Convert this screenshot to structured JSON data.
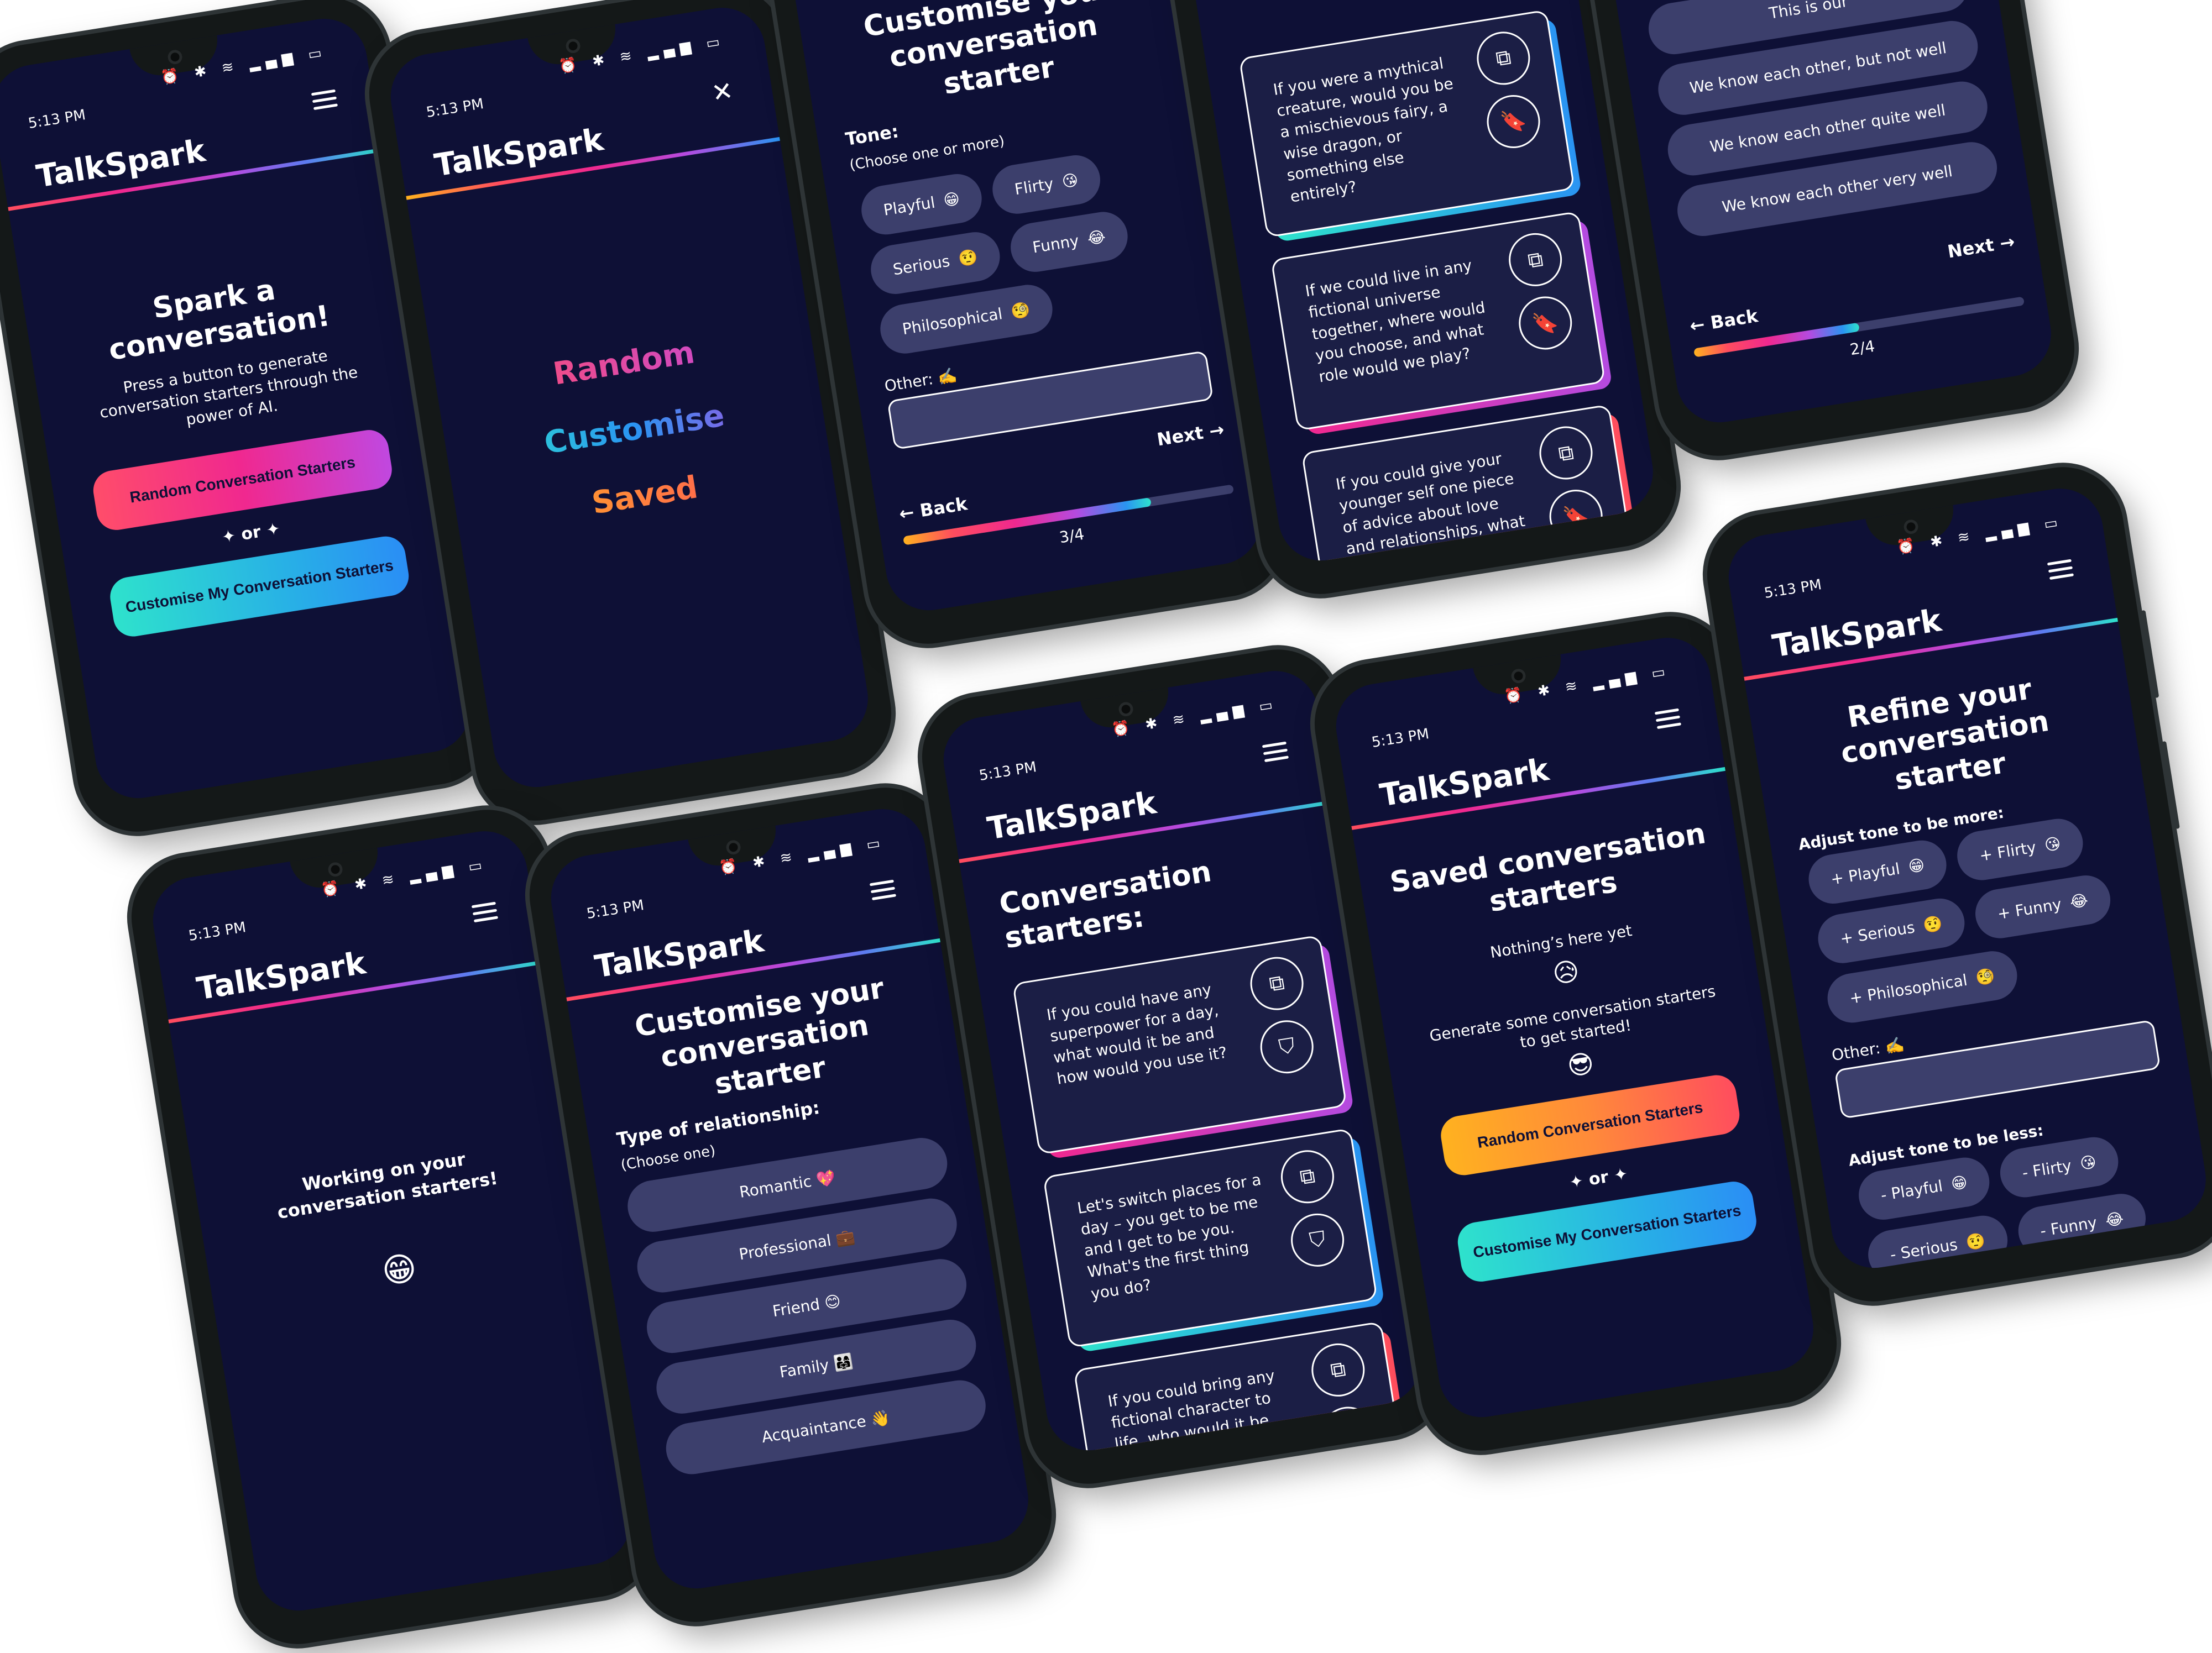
{
  "app": {
    "brand": "TalkSpark",
    "status_time": "5:13 PM",
    "status_icons": [
      "alarm-icon",
      "bluetooth-icon",
      "wifi-icon",
      "signal-icon",
      "battery-icon"
    ],
    "status_glyphs": "⏰ ✱ ≋ ▂▄▆ ▭",
    "colors": {
      "background": "#0e1036",
      "chip": "#3c3f6c",
      "card": "#1b1e45",
      "pink": "#f0288f",
      "purple": "#b44be0",
      "blue": "#2a94f2",
      "teal": "#2ee2cc",
      "orange": "#ffb21f",
      "red": "#ff4d5e"
    }
  },
  "screens": {
    "home": {
      "title": "Spark a conversation!",
      "subtitle": "Press a button to generate conversation starters through the power of AI.",
      "random_button": "Random Conversation Starters",
      "or_label": "✦ or ✦",
      "customise_button": "Customise My Conversation Starters"
    },
    "menu": {
      "close_glyph": "✕",
      "items": [
        "Random",
        "Customise",
        "Saved"
      ]
    },
    "tone_step": {
      "title": "Customise your conversation starter",
      "label": "Tone:",
      "hint": "(Choose one or more)",
      "options": [
        {
          "label": "Playful",
          "emoji": "😁"
        },
        {
          "label": "Flirty",
          "emoji": "😘"
        },
        {
          "label": "Serious",
          "emoji": "🤨"
        },
        {
          "label": "Funny",
          "emoji": "😂"
        },
        {
          "label": "Philosophical",
          "emoji": "🧐"
        }
      ],
      "other_label": "Other:",
      "other_emoji": "✍️",
      "other_value": "",
      "back": "← Back",
      "next": "Next →",
      "step_text": "3/4",
      "progress": 0.75
    },
    "results_top": {
      "cards": [
        {
          "text": "If you were a mythical creature, would you be a mischievous fairy, a wise dragon, or something else entirely?",
          "saved": true
        },
        {
          "text": "If we could live in any fictional universe together, where would you choose, and what role would we play?",
          "saved": true
        },
        {
          "text": "If you could give your younger self one piece of advice about love and relationships, what would it be?",
          "saved": true
        }
      ]
    },
    "familiarity_step": {
      "options": [
        "This is our",
        "We know each other, but not well",
        "We know each other quite well",
        "We know each other very well"
      ],
      "back": "← Back",
      "next": "Next →",
      "step_text": "2/4",
      "progress": 0.5
    },
    "loading": {
      "message": "Working on your conversation starters!",
      "emoji": "😁"
    },
    "relationship_step": {
      "title": "Customise your conversation starter",
      "label": "Type of relationship:",
      "hint": "(Choose one)",
      "options": [
        {
          "label": "Romantic",
          "emoji": "💖"
        },
        {
          "label": "Professional",
          "emoji": "💼"
        },
        {
          "label": "Friend",
          "emoji": "😊"
        },
        {
          "label": "Family",
          "emoji": "👨‍👩‍👧"
        },
        {
          "label": "Acquaintance",
          "emoji": "👋"
        }
      ]
    },
    "results": {
      "title": "Conversation starters:",
      "cards": [
        {
          "text": "If you could have any superpower for a day, what would it be and how would you use it?",
          "saved": false
        },
        {
          "text": "Let's switch places for a day – you get to be me and I get to be you. What's the first thing you do?",
          "saved": false
        },
        {
          "text": "If you could bring any fictional character to life, who would it be, and how do you think they'd handle",
          "saved": false
        }
      ]
    },
    "saved": {
      "title": "Saved conversation starters",
      "empty": "Nothing’s here yet",
      "empty_emoji": "😥",
      "prompt": "Generate some conversation starters to get started!",
      "prompt_emoji": "😎",
      "random_button": "Random Conversation Starters",
      "or_label": "✦ or ✦",
      "customise_button": "Customise My Conversation Starters"
    },
    "refine": {
      "title": "Refine your conversation starter",
      "more_label": "Adjust tone to be more:",
      "more_options": [
        {
          "label": "+ Playful",
          "emoji": "😁"
        },
        {
          "label": "+ Flirty",
          "emoji": "😘"
        },
        {
          "label": "+ Serious",
          "emoji": "🤨"
        },
        {
          "label": "+ Funny",
          "emoji": "😂"
        },
        {
          "label": "+ Philosophical",
          "emoji": "🧐"
        }
      ],
      "other_label": "Other:",
      "other_emoji": "✍️",
      "other_value": "",
      "less_label": "Adjust tone to be less:",
      "less_options": [
        {
          "label": "- Playful",
          "emoji": "😁"
        },
        {
          "label": "- Flirty",
          "emoji": "😘"
        },
        {
          "label": "- Serious",
          "emoji": "🤨"
        },
        {
          "label": "- Funny",
          "emoji": "😂"
        }
      ]
    }
  },
  "icons": {
    "copy": "⧉",
    "bookmark_filled": "🔖",
    "bookmark_outline": "⛉"
  }
}
